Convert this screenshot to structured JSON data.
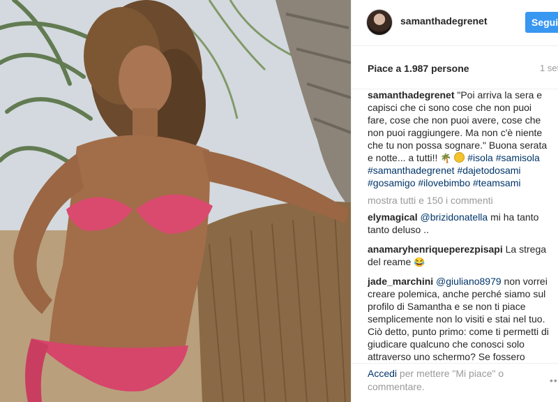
{
  "post": {
    "username": "samanthadegrenet",
    "follow_label": "Segui",
    "likes_text": "Piace a 1.987 persone",
    "date_text": "1 set"
  },
  "photo": {
    "alt_subject": "woman in pink bikini leaning on palm tree"
  },
  "caption": {
    "username": "samanthadegrenet",
    "text": "\"Poi arriva la sera e capisci che ci sono cose che non puoi fare, cose che non puoi avere, cose che non puoi raggiungere. Ma non c'è niente che tu non possa sognare.\" Buona serata e notte... a tutti!!",
    "emoji_1": "🌴",
    "hashtags": [
      "#isola",
      "#samisola",
      "#samanthadegrenet",
      "#dajetodosami",
      "#gosamigo",
      "#ilovebimbo",
      "#teamsami"
    ]
  },
  "load_more_label": "mostra tutti e 150 i commenti",
  "comments": [
    {
      "username": "elymagical",
      "mention": "@brizidonatella",
      "text": " mi ha tanto tanto deluso .."
    },
    {
      "username": "anamaryhenriqueperezpisapi",
      "text": "La strega del reame",
      "emoji": "😂"
    },
    {
      "username": "jade_marchini",
      "mention": "@giuliano8979",
      "text": " non vorrei creare polemica, anche perché siamo sul profilo di Samantha e se non ti piace semplicemente non lo visiti e stai nel tuo. Ciò detto, punto primo: come ti permetti di giudicare qualcuno che conosci solo attraverso uno schermo? Se fossero"
    }
  ],
  "footer": {
    "login_label": "Accedi",
    "rest_text": " per mettere \"Mi piace\" o commentare.",
    "more_label": "•••"
  },
  "colors": {
    "follow_button": "#3897f0",
    "link": "#003569",
    "muted": "#999999",
    "text": "#262626"
  }
}
